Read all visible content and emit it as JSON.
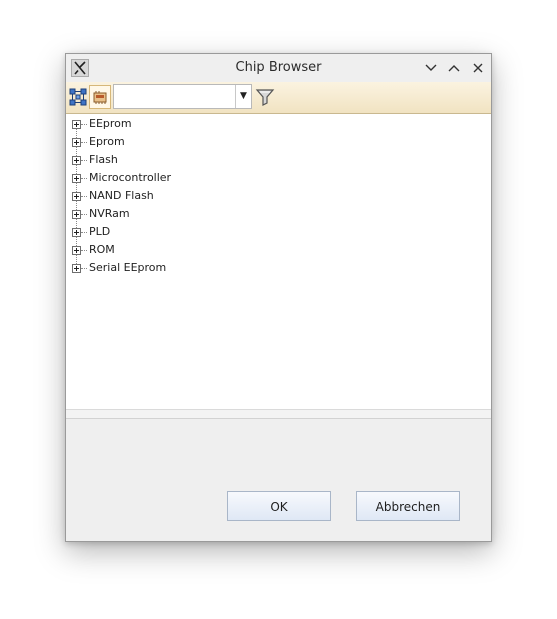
{
  "window": {
    "title": "Chip Browser",
    "icons": {
      "app": "x-app-icon",
      "minimize": "chevron-down-icon",
      "maximize": "chevron-up-icon",
      "close": "close-icon"
    }
  },
  "toolbar": {
    "buttons": [
      {
        "name": "chip-tree-view-button",
        "icon": "network-tree-icon"
      },
      {
        "name": "chip-device-view-button",
        "icon": "chip-device-icon"
      }
    ],
    "search": {
      "value": "",
      "placeholder": ""
    },
    "filter_icon": "funnel-icon"
  },
  "tree": {
    "items": [
      {
        "label": "EEprom"
      },
      {
        "label": "Eprom"
      },
      {
        "label": "Flash"
      },
      {
        "label": "Microcontroller"
      },
      {
        "label": "NAND Flash"
      },
      {
        "label": "NVRam"
      },
      {
        "label": "PLD"
      },
      {
        "label": "ROM"
      },
      {
        "label": "Serial EEprom"
      }
    ]
  },
  "buttons": {
    "ok": "OK",
    "cancel": "Abbrechen"
  },
  "colors": {
    "toolbar_bg": "#f3e6c6",
    "button_bg": "#dfe8f5",
    "window_bg": "#efefef"
  }
}
